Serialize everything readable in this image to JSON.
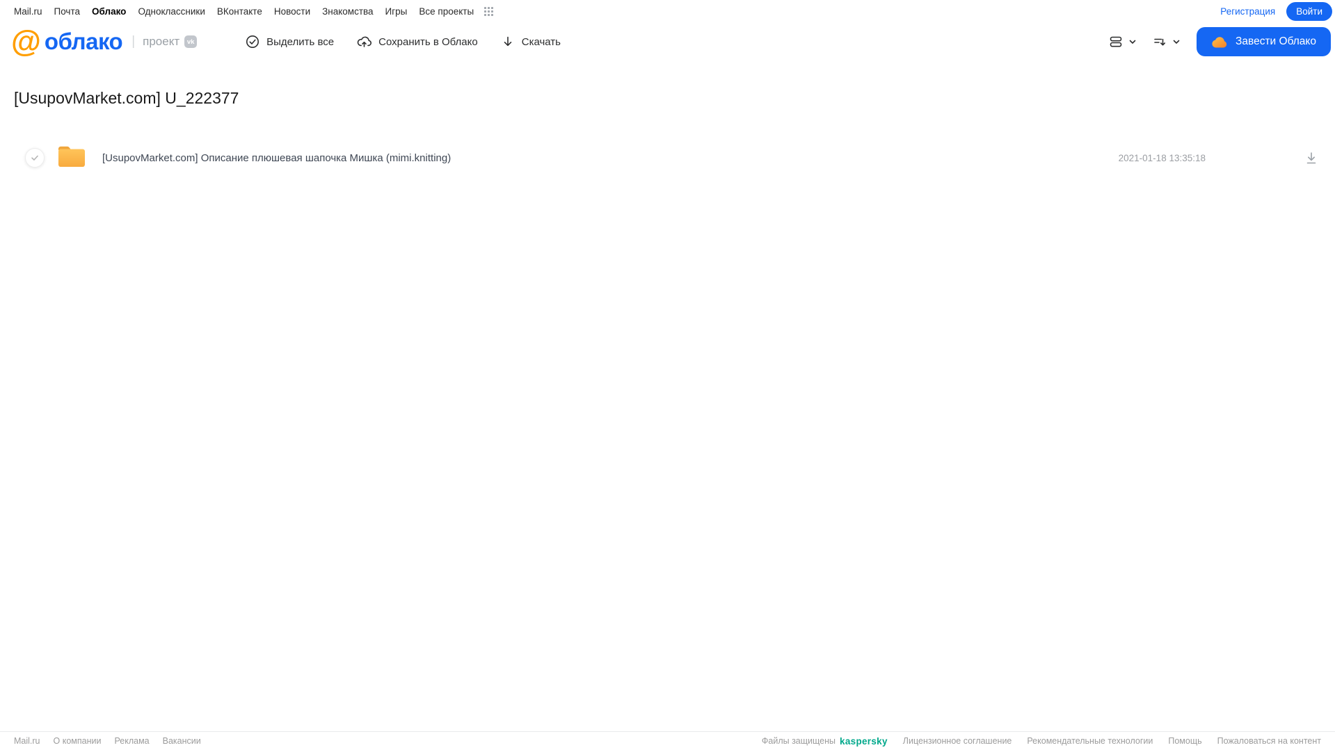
{
  "top_nav": {
    "items": [
      "Mail.ru",
      "Почта",
      "Облако",
      "Одноклассники",
      "ВКонтакте",
      "Новости",
      "Знакомства",
      "Игры",
      "Все проекты"
    ],
    "active_item": "Облако",
    "register_label": "Регистрация",
    "login_label": "Войти"
  },
  "header": {
    "logo": {
      "at": "@",
      "name": "облако",
      "divider": "|",
      "project": "проект",
      "vk": "vk"
    },
    "toolbar": {
      "select_all": "Выделить все",
      "save_to_cloud": "Сохранить в Облако",
      "download": "Скачать"
    },
    "cta_label": "Завести Облако"
  },
  "main": {
    "title": "[UsupovMarket.com] U_222377",
    "files": [
      {
        "type": "folder",
        "name": "[UsupovMarket.com] Описание плюшевая шапочка Мишка (mimi.knitting)",
        "date": "2021-01-18 13:35:18"
      }
    ]
  },
  "footer": {
    "left_links": [
      "Mail.ru",
      "О компании",
      "Реклама",
      "Вакансии"
    ],
    "protected_text": "Файлы защищены",
    "kaspersky_label": "kaspersky",
    "right_links": [
      "Лицензионное соглашение",
      "Рекомендательные технологии",
      "Помощь",
      "Пожаловаться на контент"
    ]
  },
  "colors": {
    "accent_blue": "#1567f3",
    "logo_orange": "#ff9e00",
    "folder_yellow_top": "#ffc45a",
    "folder_yellow_bottom": "#f8ab3e",
    "kaspersky_teal": "#00a88b",
    "muted_gray": "#9b9ea3"
  }
}
